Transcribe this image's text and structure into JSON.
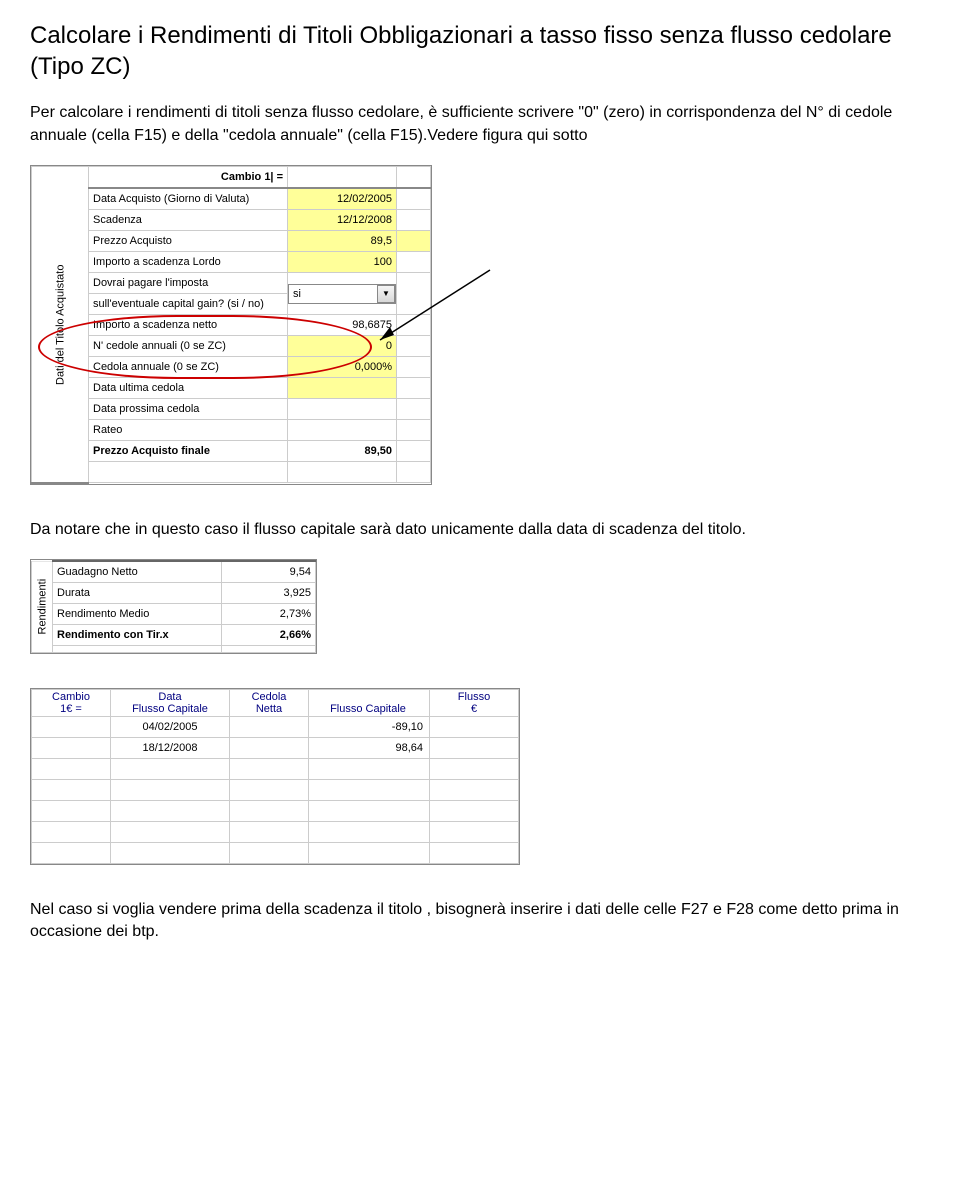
{
  "title": "Calcolare i Rendimenti di Titoli Obbligazionari a tasso fisso senza flusso cedolare (Tipo ZC)",
  "para1": "Per calcolare i rendimenti di titoli senza flusso cedolare, è sufficiente scrivere \"0\" (zero) in corrispondenza del N° di cedole annuale (cella F15) e della \"cedola annuale\" (cella F15).Vedere figura qui sotto",
  "para2": "Da notare che in questo caso il flusso capitale sarà dato unicamente dalla data di scadenza del titolo.",
  "para3": "Nel caso si voglia vendere prima della scadenza il titolo , bisognerà inserire i dati delle celle F27 e F28 come detto prima in occasione dei btp.",
  "fig1": {
    "vert_label": "Dati del Titolo Acquistato",
    "cambio_label": "Cambio 1| =",
    "rows": {
      "r1l": "Data Acquisto (Giorno di Valuta)",
      "r1v": "12/02/2005",
      "r2l": "Scadenza",
      "r2v": "12/12/2008",
      "r3l": "Prezzo Acquisto",
      "r3v": "89,5",
      "r4l": "Importo a scadenza Lordo",
      "r4v": "100",
      "r5l": "Dovrai pagare l'imposta",
      "r6l": "sull'eventuale capital gain? (si / no)",
      "r6v": "si",
      "r7l": "Importo a scadenza netto",
      "r7v": "98,6875",
      "r8l": "N' cedole annuali (0 se ZC)",
      "r8v": "0",
      "r9l": "Cedola annuale (0 se ZC)",
      "r9v": "0,000%",
      "r10l": "Data ultima cedola",
      "r11l": "Data prossima cedola",
      "r12l": "Rateo",
      "r13l": "Prezzo Acquisto finale",
      "r13v": "89,50"
    }
  },
  "fig2": {
    "vert_label": "Rendimenti",
    "rows": {
      "r1l": "Guadagno Netto",
      "r1v": "9,54",
      "r2l": "Durata",
      "r2v": "3,925",
      "r3l": "Rendimento Medio",
      "r3v": "2,73%",
      "r4l": "Rendimento con Tir.x",
      "r4v": "2,66%"
    }
  },
  "fig3": {
    "headers": {
      "h1a": "Cambio",
      "h1b": "1€ =",
      "h2a": "Data",
      "h2b": "Flusso Capitale",
      "h3a": "Cedola",
      "h3b": "Netta",
      "h4": "Flusso Capitale",
      "h5a": "Flusso",
      "h5b": "€"
    },
    "rows": [
      {
        "date": "04/02/2005",
        "flow": "-89,10"
      },
      {
        "date": "18/12/2008",
        "flow": "98,64"
      }
    ]
  }
}
